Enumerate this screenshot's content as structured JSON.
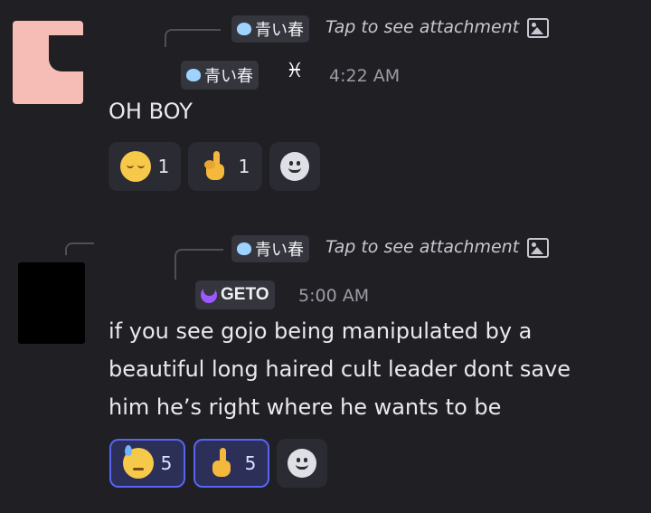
{
  "messages": [
    {
      "reply": {
        "tag": "青い春",
        "link": "Tap to see attachment"
      },
      "author_tag": "青い春",
      "badge_symbol": "♓",
      "time": "4:22 AM",
      "lines": [
        "OH BOY"
      ],
      "reactions": [
        {
          "emoji": "relieved-face",
          "count": "1",
          "active": false
        },
        {
          "emoji": "pinched-hand",
          "count": "1",
          "active": false
        },
        {
          "emoji": "add-reaction",
          "count": "",
          "active": false
        }
      ]
    },
    {
      "reply": {
        "tag": "青い春",
        "link": "Tap to see attachment"
      },
      "author_tag": "GETO",
      "time": "5:00 AM",
      "lines": [
        "if you see gojo being manipulated by a",
        "beautiful long haired cult leader dont save",
        "him he’s right where he wants to be"
      ],
      "reactions": [
        {
          "emoji": "sweat-face",
          "count": "5",
          "active": true
        },
        {
          "emoji": "pointing-hand",
          "count": "5",
          "active": true
        },
        {
          "emoji": "add-reaction",
          "count": "",
          "active": false
        }
      ]
    }
  ],
  "colors": {
    "background": "#1f1f24",
    "accent": "#5865f2",
    "tag_bg": "#34353d"
  }
}
